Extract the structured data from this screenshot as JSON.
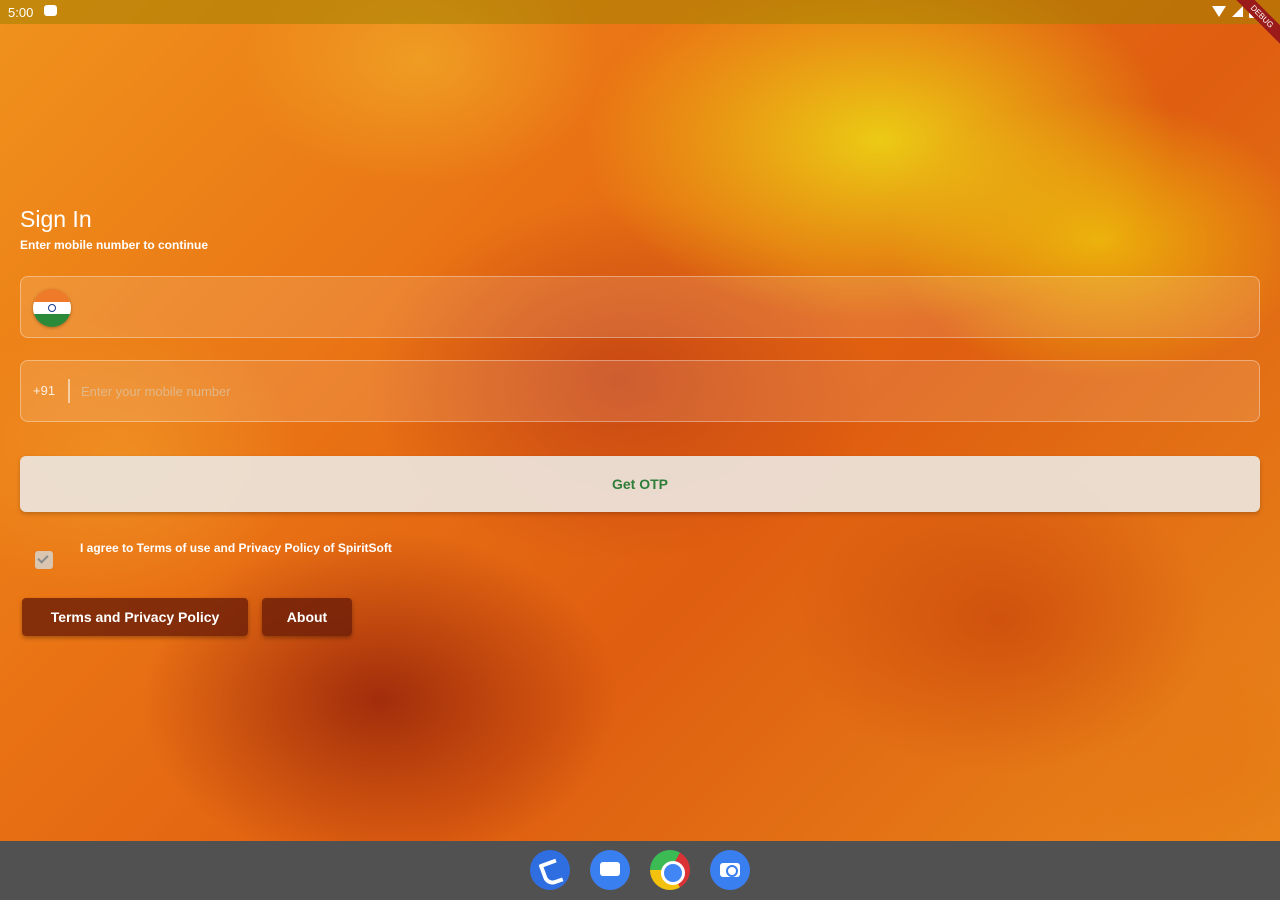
{
  "status_bar": {
    "time": "5:00"
  },
  "debug_banner": "DEBUG",
  "signin": {
    "title": "Sign In",
    "subtitle": "Enter mobile number to continue",
    "country_code": "+91",
    "phone_placeholder": "Enter your mobile number",
    "phone_value": "",
    "get_otp_label": "Get OTP",
    "agree_text": "I agree to Terms of use and Privacy Policy of  SpiritSoft",
    "agree_checked": true,
    "terms_button_label": "Terms and Privacy Policy",
    "about_button_label": "About"
  },
  "dock": {
    "apps": [
      "phone-icon",
      "messages-icon",
      "chrome-icon",
      "camera-icon"
    ]
  },
  "colors": {
    "otp_text": "#2f7d3a",
    "dark_button": "#6e1e08",
    "navbar": "#515151"
  }
}
